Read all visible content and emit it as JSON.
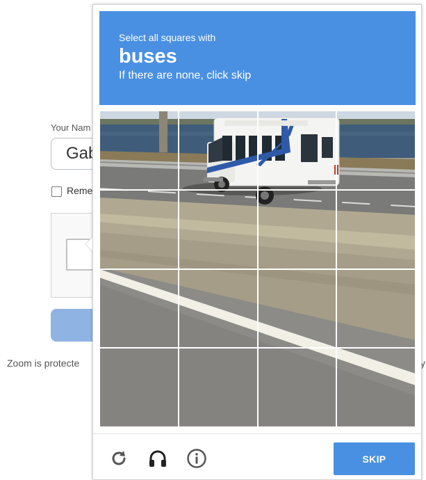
{
  "background_page": {
    "name_label": "Your Nam",
    "name_value": "Gab",
    "remember_label": "Reme",
    "footer_text": "Zoom is protecte",
    "footer_tail": "y"
  },
  "captcha": {
    "instruction_prefix": "Select all squares with",
    "target_object": "buses",
    "instruction_suffix": "If there are none, click skip",
    "grid_size": "4x4",
    "tile_count": 16,
    "skip_label": "SKIP",
    "controls": [
      "refresh-icon",
      "audio-headphones-icon",
      "info-icon"
    ],
    "accent_color": "#4a90e2"
  }
}
